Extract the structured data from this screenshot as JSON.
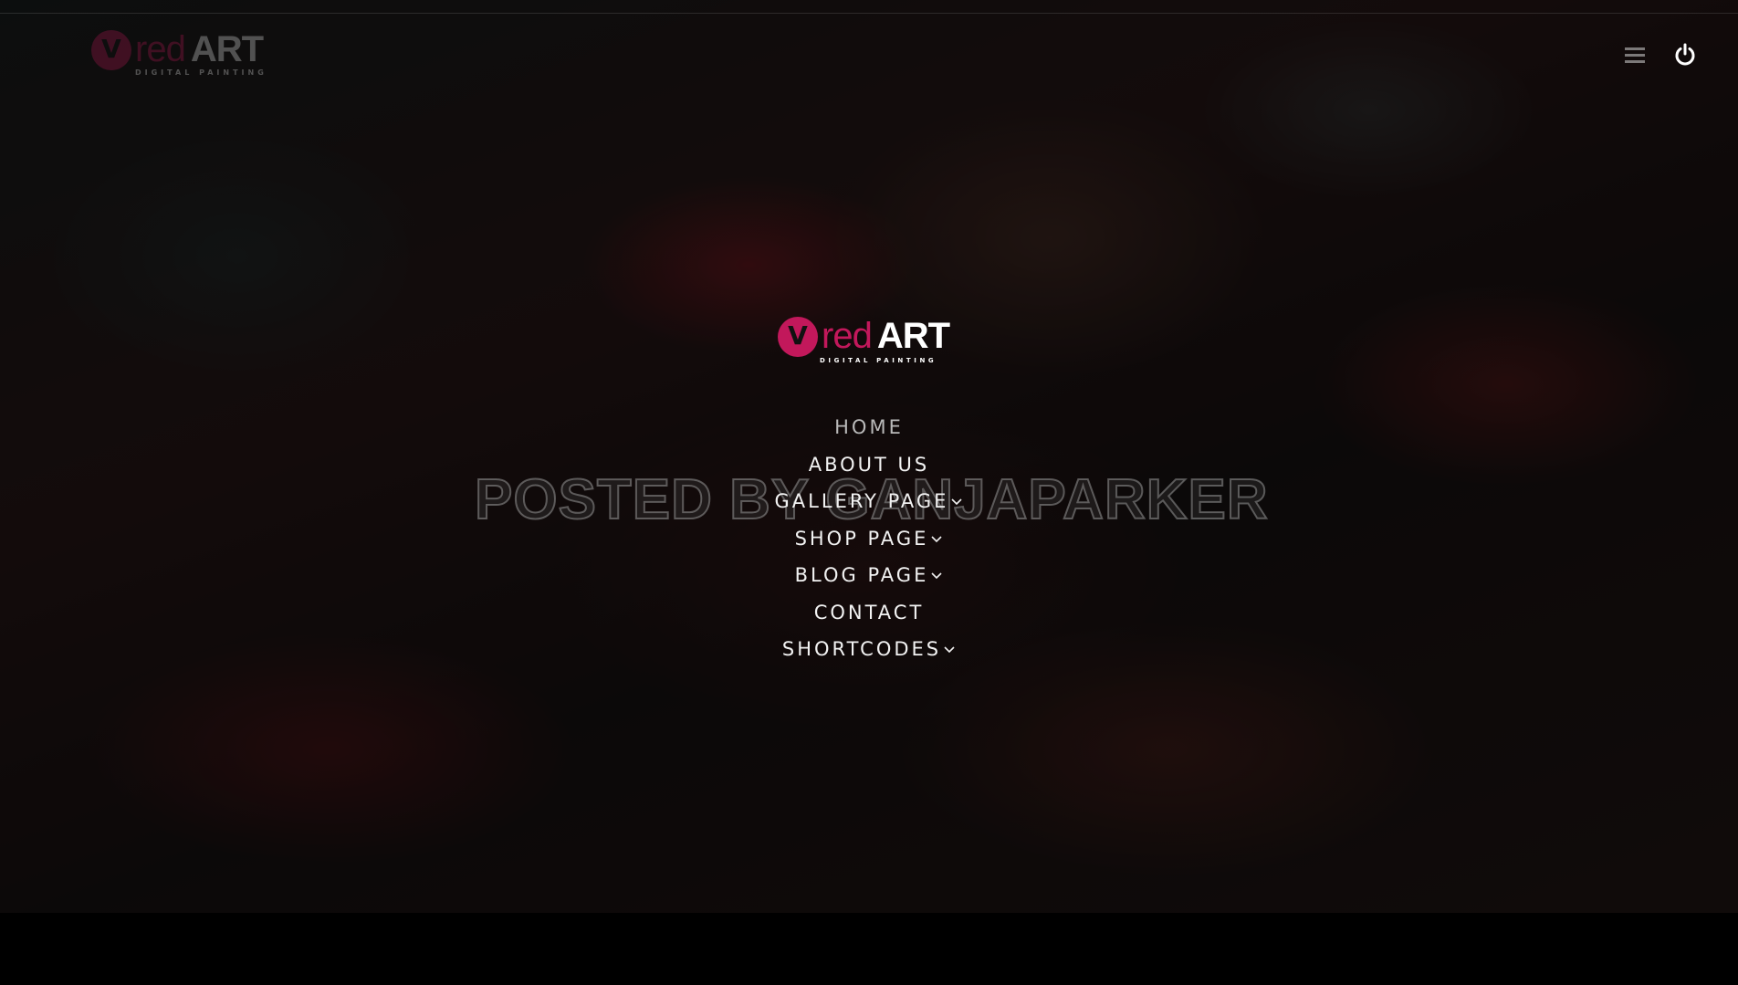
{
  "brand": {
    "red_word": "red",
    "art_word": "ART",
    "tagline": "DIGITAL PAINTING",
    "mark_letter": "V",
    "accent_color": "#c2185b"
  },
  "header": {
    "menu_icon": "hamburger-icon",
    "power_icon": "power-icon"
  },
  "nav": {
    "items": [
      {
        "label": "HOME",
        "has_dropdown": false,
        "active": true
      },
      {
        "label": "ABOUT US",
        "has_dropdown": false
      },
      {
        "label": "GALLERY PAGE",
        "has_dropdown": true
      },
      {
        "label": "SHOP PAGE",
        "has_dropdown": true
      },
      {
        "label": "BLOG PAGE",
        "has_dropdown": true
      },
      {
        "label": "CONTACT",
        "has_dropdown": false
      },
      {
        "label": "SHORTCODES",
        "has_dropdown": true
      }
    ]
  },
  "watermark": "POSTED BY GANJAPARKER"
}
